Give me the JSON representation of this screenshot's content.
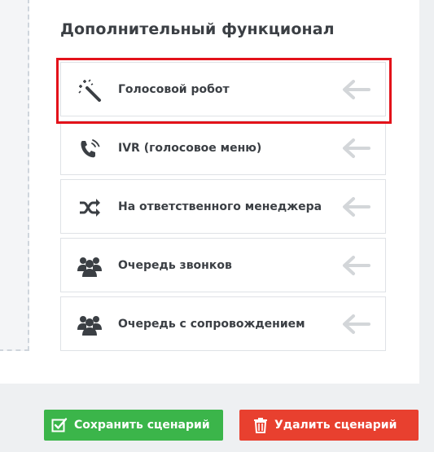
{
  "panel": {
    "heading": "Дополнительный функционал",
    "items": [
      {
        "label": "Голосовой робот",
        "icon": "magic-wand-icon",
        "selected": true
      },
      {
        "label": "IVR (голосовое меню)",
        "icon": "phone-signal-icon",
        "selected": false
      },
      {
        "label": "На ответственного менеджера",
        "icon": "shuffle-icon",
        "selected": false
      },
      {
        "label": "Очередь звонков",
        "icon": "users-group-icon",
        "selected": false
      },
      {
        "label": "Очередь с сопровождением",
        "icon": "users-group-icon",
        "selected": false
      }
    ],
    "highlight_color": "#e3121a",
    "arrow_color": "#d3d6d9"
  },
  "actions": {
    "save_label": "Сохранить сценарий",
    "delete_label": "Удалить сценарий",
    "save_color": "#3bb54a",
    "delete_color": "#e8402f"
  }
}
